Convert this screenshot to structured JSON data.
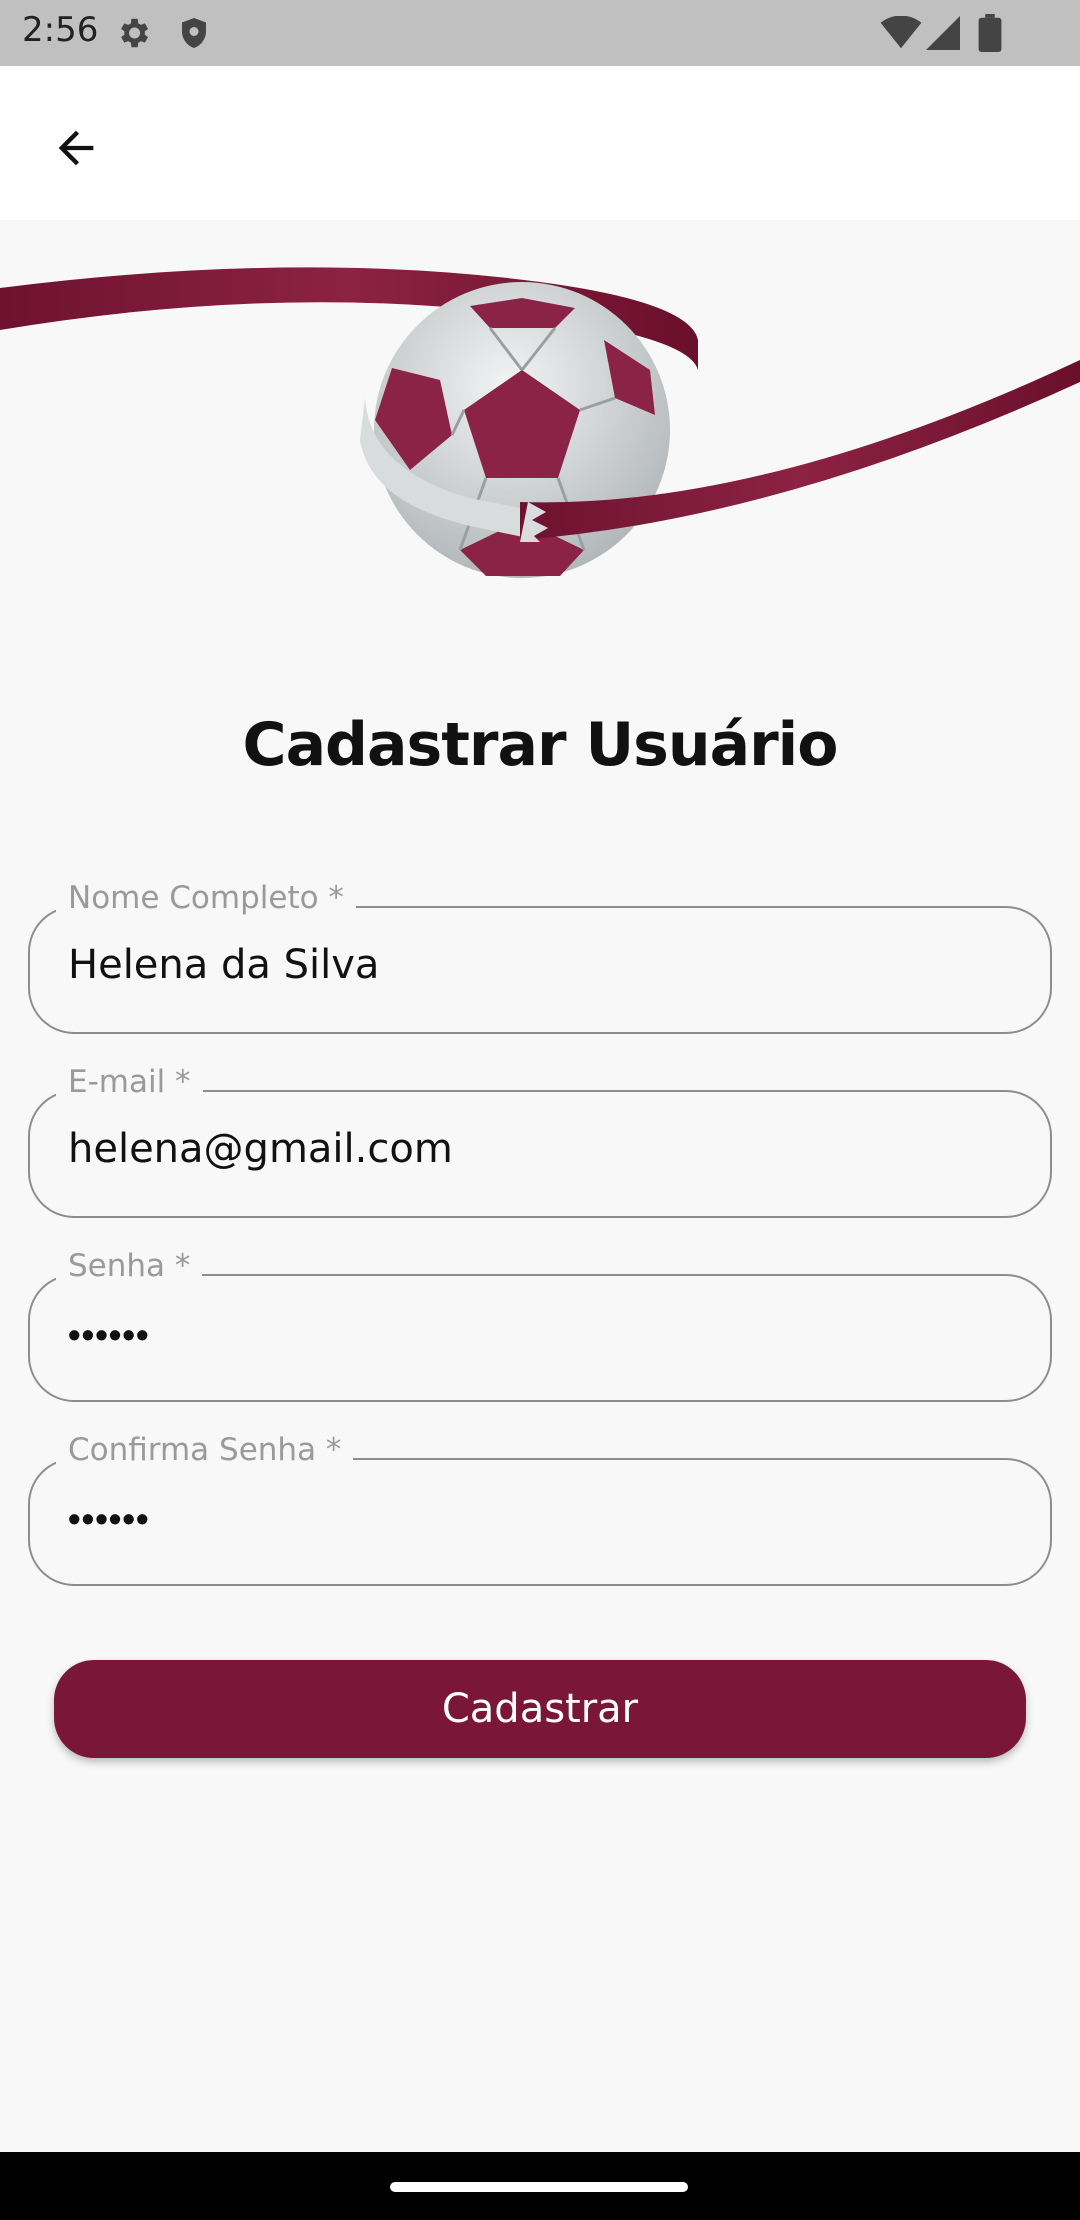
{
  "status_bar": {
    "time": "2:56",
    "icons": [
      "gear-icon",
      "shield-icon",
      "wifi-icon",
      "signal-icon",
      "battery-icon"
    ]
  },
  "app_bar": {
    "back_icon": "arrow-left-icon"
  },
  "page": {
    "title": "Cadastrar Usuário"
  },
  "form": {
    "fields": [
      {
        "label": "Nome Completo *",
        "value": "Helena da Silva",
        "type": "text"
      },
      {
        "label": "E-mail *",
        "value": "helena@gmail.com",
        "type": "email"
      },
      {
        "label": "Senha *",
        "value": "••••••",
        "type": "password"
      },
      {
        "label": "Confirma Senha *",
        "value": "••••••",
        "type": "password"
      }
    ],
    "submit_label": "Cadastrar"
  },
  "colors": {
    "accent": "#7a1637",
    "background": "#f8f8f8",
    "status_bar": "#c0c0c0"
  }
}
